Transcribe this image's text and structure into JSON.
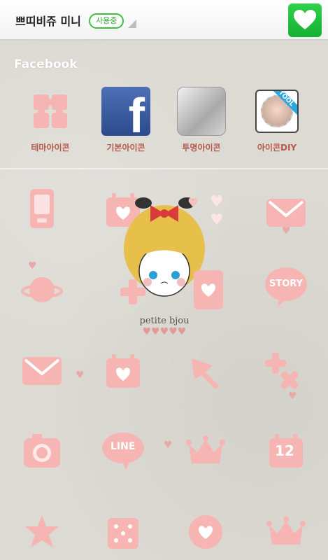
{
  "header": {
    "title": "쁘띠비쥬 미니",
    "status": "사용중"
  },
  "section_label": "Facebook",
  "dock": [
    {
      "label": "테마아이콘",
      "icon": "puzzle-icon"
    },
    {
      "label": "기본아이콘",
      "icon": "facebook-icon"
    },
    {
      "label": "투명아이콘",
      "icon": "transparent-icon"
    },
    {
      "label": "아이콘DIY",
      "icon": "photo-icon",
      "ribbon": "TOOL"
    }
  ],
  "character": {
    "caption": "petite bjou"
  },
  "grid_icons": [
    "phone-icon",
    "calendar-icon",
    "envelope-icon",
    "planet-icon",
    "story-bubble-icon",
    "envelope-icon",
    "calendar-icon",
    "ribbon-icon",
    "plus-x-icon",
    "camera-icon",
    "line-bubble-icon",
    "crown-icon",
    "calendar-12-icon",
    "star-icon",
    "dice-icon",
    "heart-icon",
    "crown-icon"
  ],
  "calendar_day": "12",
  "story_text": "STORY",
  "line_text": "LINE",
  "colors": {
    "accent_pink": "#f6b5b3",
    "label_red": "#b75a4a",
    "green": "#1fc23d"
  }
}
